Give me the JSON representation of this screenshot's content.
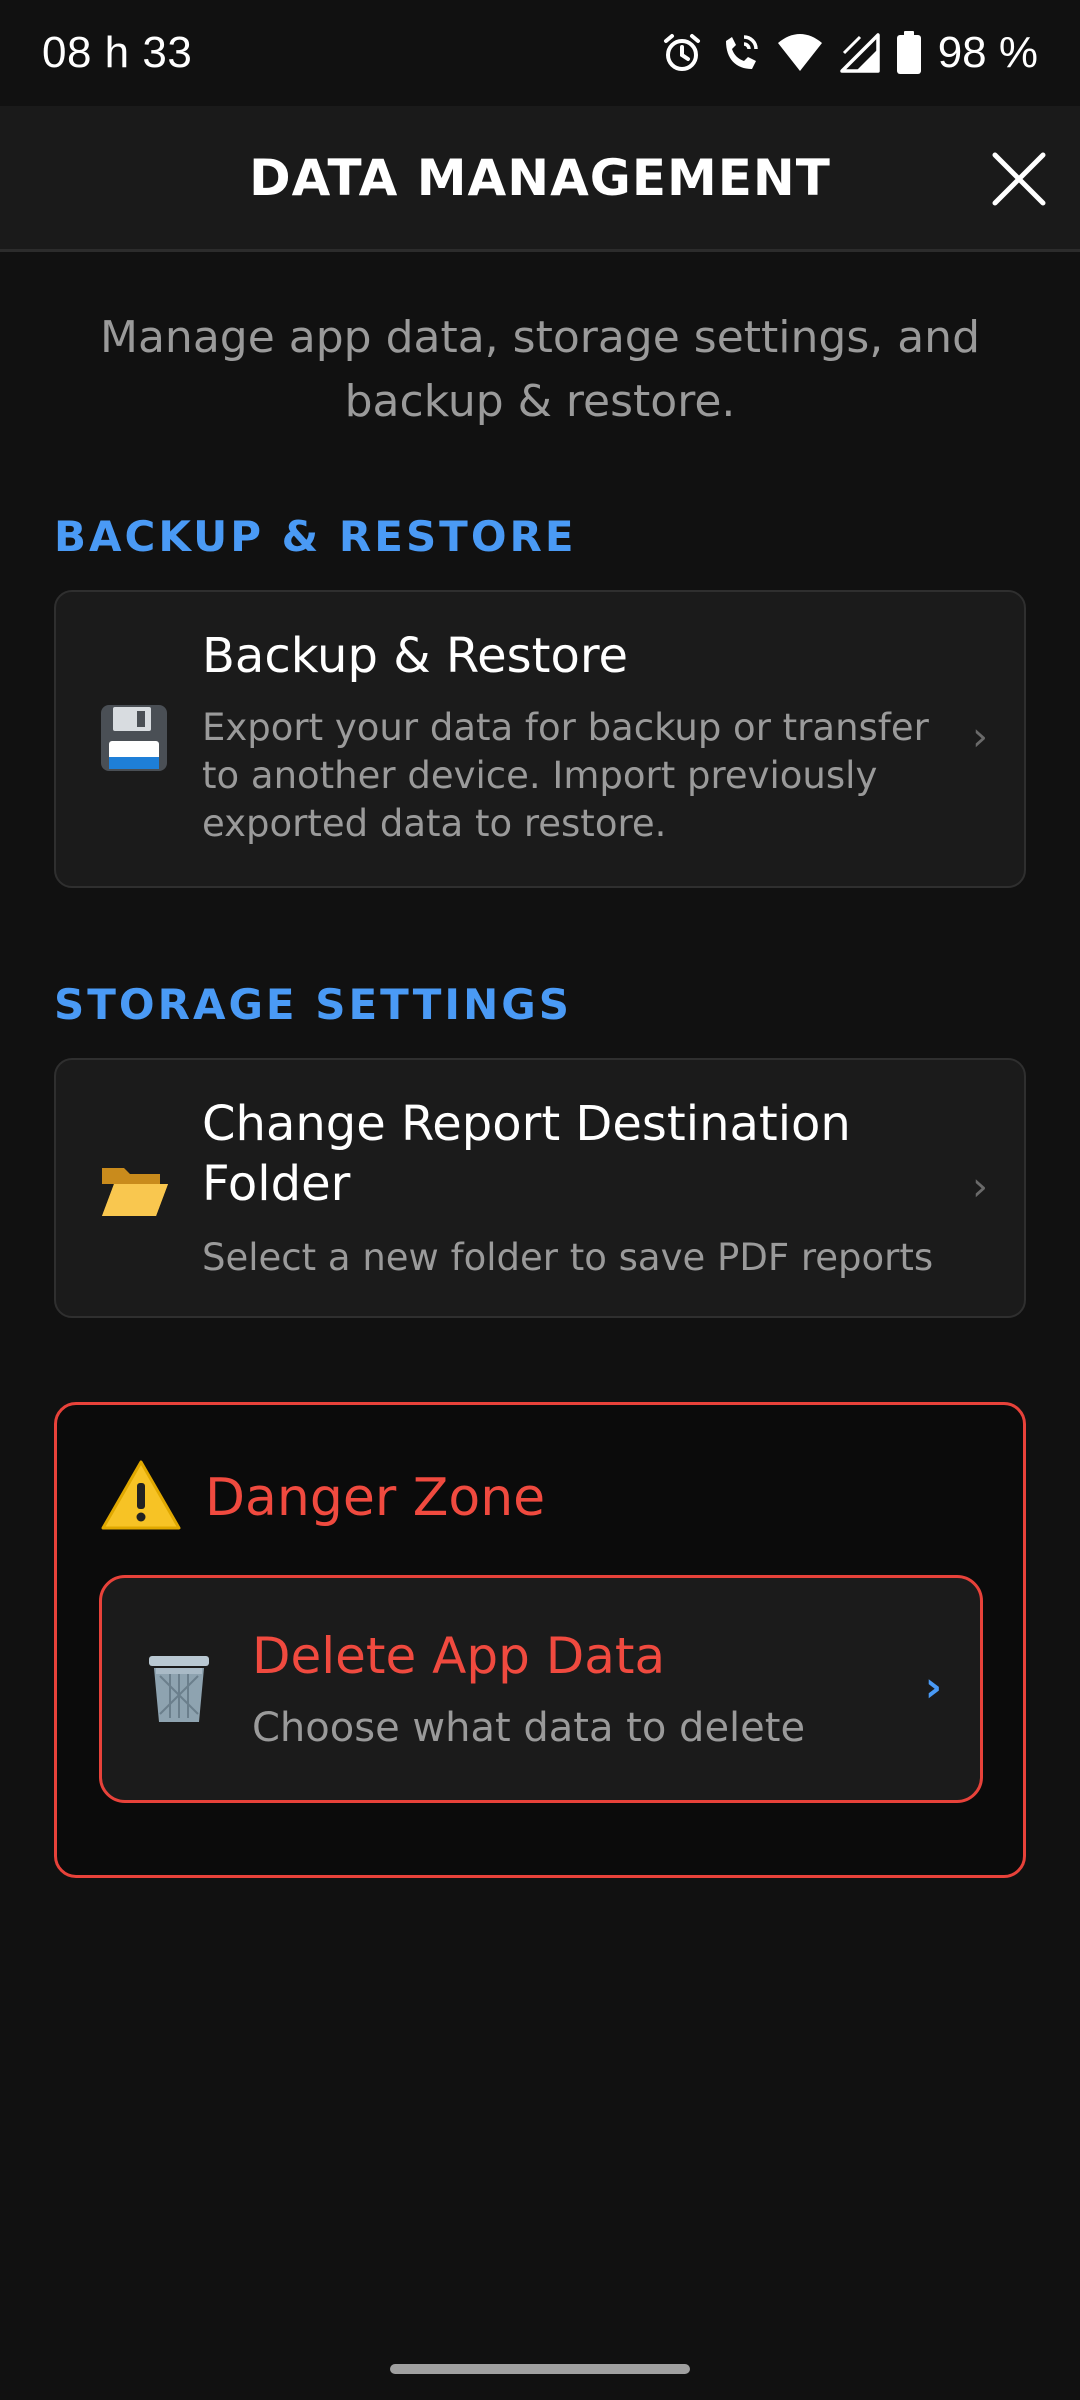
{
  "status_bar": {
    "time": "08 h 33",
    "battery": "98 %",
    "icons": [
      "alarm-icon",
      "wifi-calling-icon",
      "wifi-icon",
      "signal-icon",
      "battery-icon"
    ]
  },
  "header": {
    "title": "DATA MANAGEMENT",
    "close_icon": "close-icon"
  },
  "subtitle": "Manage app data, storage settings, and backup & restore.",
  "sections": {
    "backup": {
      "label": "BACKUP & RESTORE",
      "card": {
        "icon": "floppy-disk-icon",
        "title": "Backup & Restore",
        "description": "Export your data for backup or transfer to another device. Import previously exported data to restore.",
        "chevron": "›"
      }
    },
    "storage": {
      "label": "STORAGE SETTINGS",
      "card": {
        "icon": "open-folder-icon",
        "title": "Change Report Destination Folder",
        "description": "Select a new folder to save PDF reports",
        "chevron": "›"
      }
    },
    "danger": {
      "icon": "warning-icon",
      "title": "Danger Zone",
      "delete_card": {
        "icon": "trash-icon",
        "title": "Delete App Data",
        "description": "Choose what data to delete",
        "chevron": "›"
      }
    }
  },
  "colors": {
    "background": "#111111",
    "accent_blue": "#4a9af5",
    "danger_red": "#f04a3f",
    "card_bg": "#1b1b1b",
    "muted_text": "#9a9a9a"
  }
}
